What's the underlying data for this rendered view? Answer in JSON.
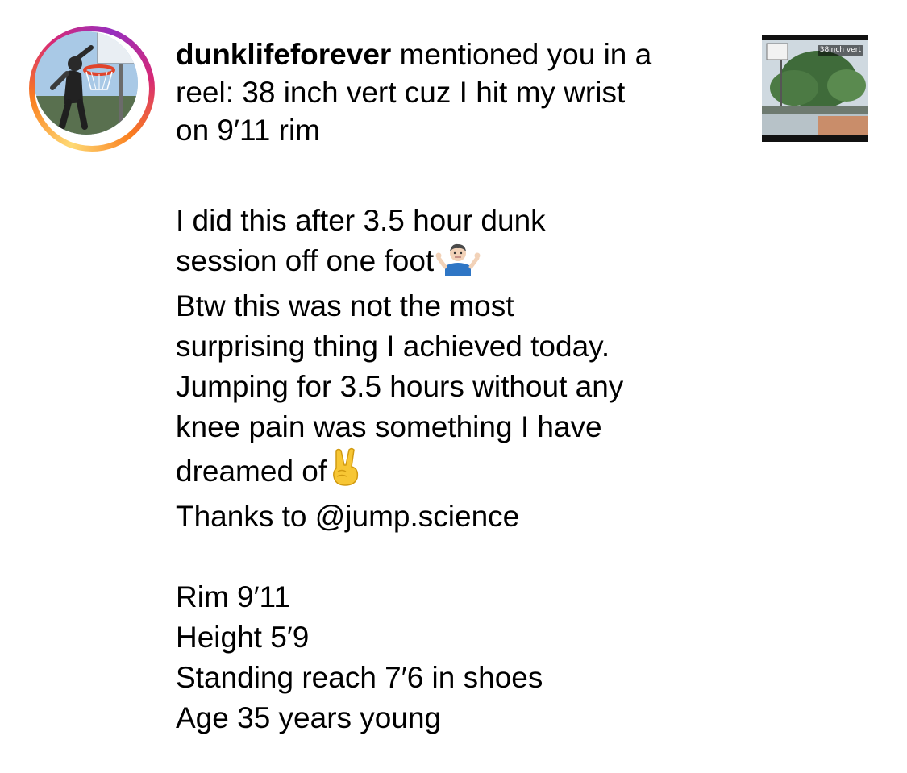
{
  "notification": {
    "username": "dunklifeforever",
    "action_text": " mentioned you in a",
    "line2": "reel: 38 inch vert cuz I hit my wrist",
    "line3": "on 9′11 rim"
  },
  "thumbnail": {
    "caption": "38inch vert"
  },
  "caption": {
    "lines": [
      "I did this after 3.5 hour dunk",
      "session off one foot",
      "Btw this was not the most",
      "surprising thing I achieved today.",
      "Jumping for 3.5 hours without any",
      "knee pain was something I have",
      "dreamed of",
      "Thanks to @jump.science"
    ],
    "stats": [
      "Rim 9′11",
      "Height 5′9",
      "Standing reach 7′6 in shoes",
      "Age 35 years young"
    ],
    "icons": {
      "line2": "shrug-emoji",
      "line7": "victory-hand-emoji"
    }
  }
}
